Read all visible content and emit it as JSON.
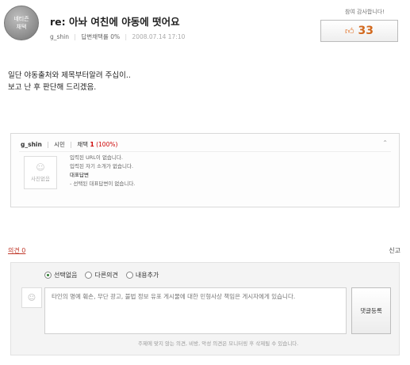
{
  "question": {
    "badge_line1": "네티즌",
    "badge_line2": "채택",
    "title_prefix": "re:",
    "title": "아놔 여친에 야동에 떳어요",
    "author": "g_shin",
    "adoption_rate": "답변채택률 0%",
    "date": "2008.07.14 17:10"
  },
  "thanks": {
    "label": "참여 감사합니다!",
    "thumb_icon": "thumbs-up-icon",
    "count": "33"
  },
  "body": {
    "line1": "일단 야동출처와 제목부터알려 주십이..",
    "line2": "보고 난 후 판단해 드리겠음."
  },
  "profile": {
    "name": "g_shin",
    "rank": "시민",
    "adopt_label": "채택",
    "adopt_count": "1",
    "adopt_pct": "(100%)",
    "collapse_icon": "chevron-up-icon",
    "photo_label": "사진없음",
    "url_text": "입력된 URL이 없습니다.",
    "intro_text": "입력된 자기 소개가 없습니다.",
    "rep_title": "대표답변",
    "rep_text": "- 선택된 대표답변이 없습니다."
  },
  "opinion": {
    "label": "의견 0",
    "report": "신고"
  },
  "comment_form": {
    "options": [
      "선택없음",
      "다른의견",
      "내용추가"
    ],
    "selected": "선택없음",
    "placeholder": "타인의 명예 훼손, 무단 광고, 불법 정보 유포 게시물에 대한 민형사상 책임은 게시자에게 있습니다.",
    "submit": "댓글등록",
    "notice": "주제에 맞지 않는 의견, 비방, 악성 의견은 모니터링 후 삭제될 수 있습니다."
  },
  "colors": {
    "accent_orange": "#d2691e",
    "opinion_red": "#c0392b",
    "radio_green": "#2e7d32"
  }
}
